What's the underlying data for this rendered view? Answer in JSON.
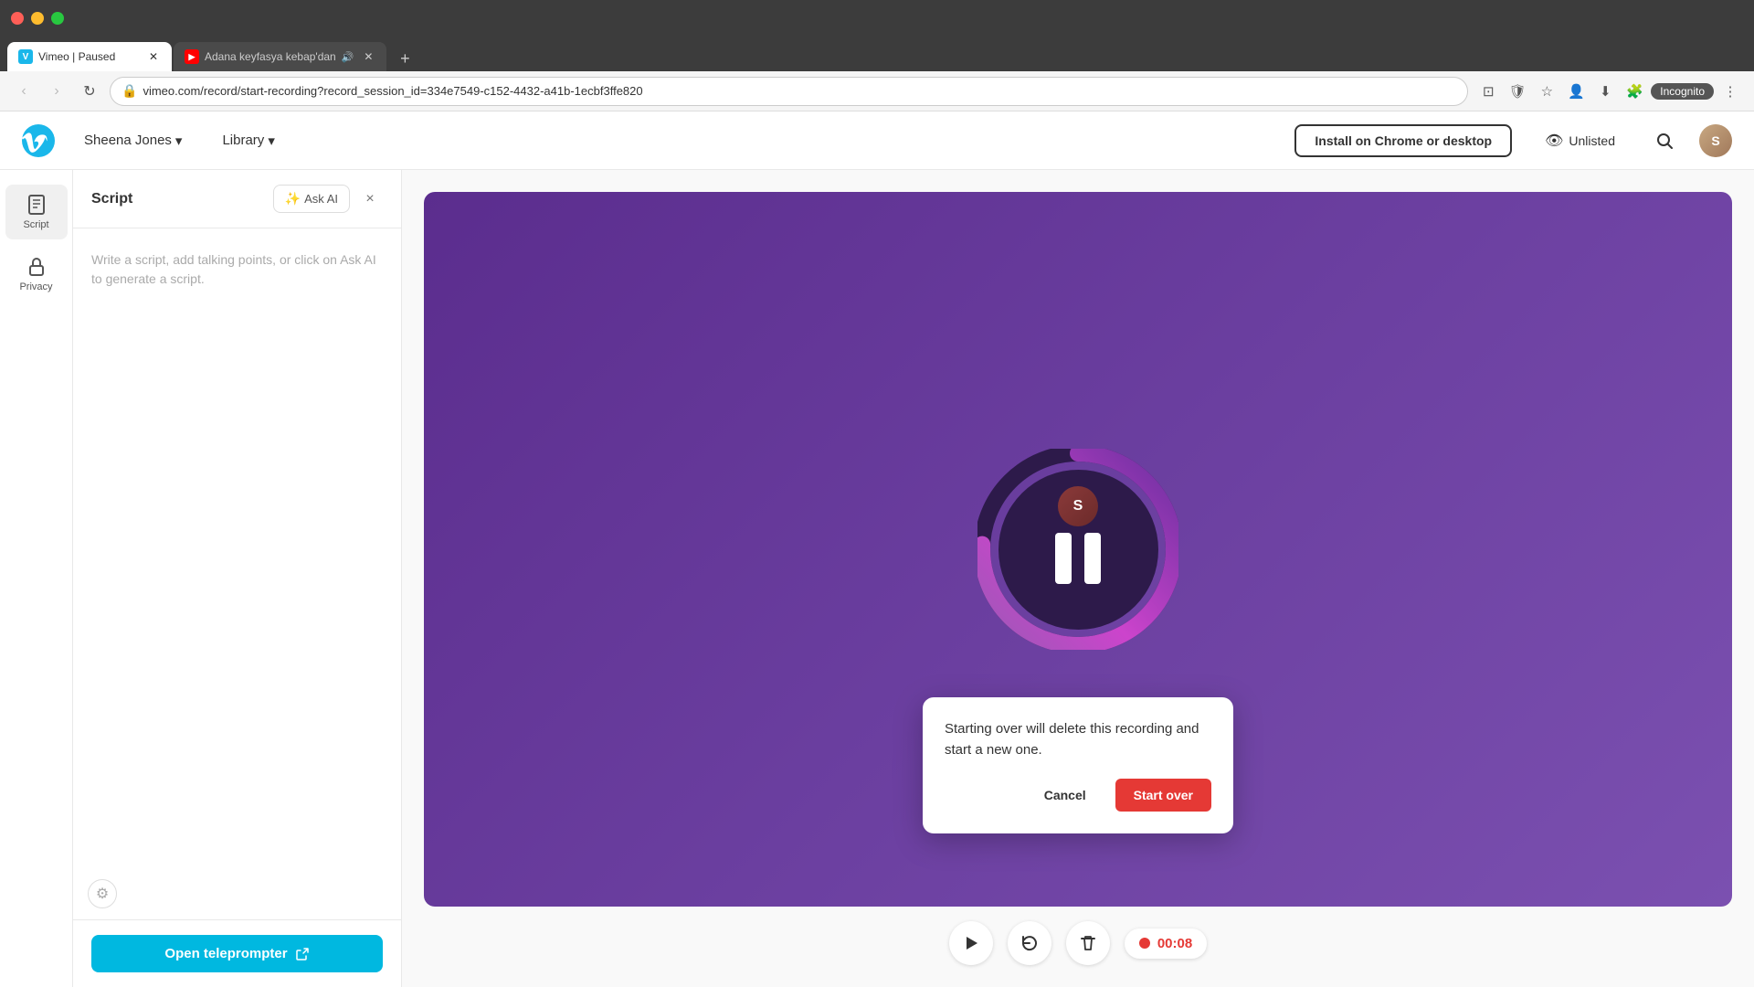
{
  "browser": {
    "tabs": [
      {
        "id": "tab1",
        "title": "Vimeo | Paused",
        "favicon": "V",
        "active": true,
        "audible": false
      },
      {
        "id": "tab2",
        "title": "Adana keyfasya kebap'dan",
        "favicon": "YT",
        "active": false,
        "audible": true
      }
    ],
    "new_tab_label": "+",
    "url": "vimeo.com/record/start-recording?record_session_id=334e7549-c152-4432-a41b-1ecbf3ffe820",
    "incognito_label": "Incognito"
  },
  "header": {
    "user_name": "Sheena Jones",
    "library_label": "Library",
    "install_button_label": "Install on Chrome or desktop",
    "unlisted_label": "Unlisted"
  },
  "sidebar": {
    "items": [
      {
        "id": "script",
        "label": "Script",
        "icon": "📄"
      },
      {
        "id": "privacy",
        "label": "Privacy",
        "icon": "🔒"
      }
    ]
  },
  "script_panel": {
    "title": "Script",
    "ask_ai_label": "Ask AI",
    "close_label": "×",
    "placeholder": "Write a script, add talking points, or click on Ask AI to generate a script."
  },
  "teleprompter": {
    "button_label": "Open teleprompter"
  },
  "recording": {
    "time": "00:08",
    "paused": true
  },
  "dialog": {
    "message": "Starting over will delete this recording and start a new one.",
    "cancel_label": "Cancel",
    "confirm_label": "Start over"
  },
  "controls": {
    "play_icon": "▶",
    "restart_icon": "↺",
    "delete_icon": "🗑"
  },
  "colors": {
    "accent_blue": "#00b8e0",
    "record_red": "#e53935",
    "video_bg": "#5b2d8e",
    "brand_blue": "#1ab7ea"
  }
}
